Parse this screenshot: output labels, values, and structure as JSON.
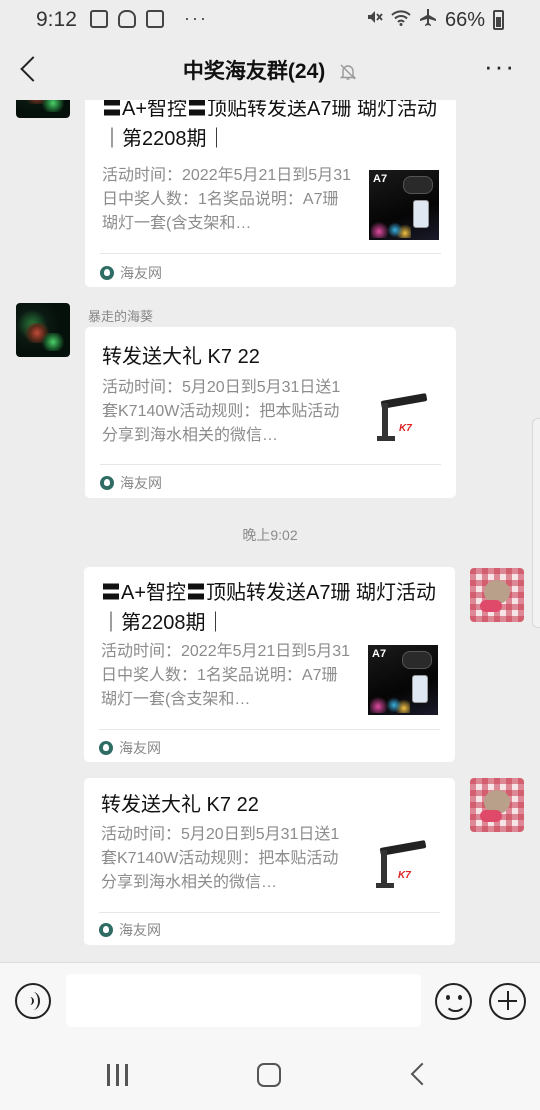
{
  "status_bar": {
    "time": "9:12",
    "more": "···",
    "battery": "66%",
    "icons": [
      "gallery-icon",
      "cloud-icon",
      "d-icon",
      "mute-icon",
      "wifi-icon",
      "airplane-icon",
      "battery-icon"
    ]
  },
  "header": {
    "title": "中奖海友群(24)",
    "more": "···"
  },
  "messages": [
    {
      "direction": "incoming",
      "sender": "",
      "card": {
        "title": "〓A+智控〓顶贴转发送A7珊 瑚灯活动｜第2208期｜",
        "desc": "活动时间：2022年5月21日到5月31日中奖人数：1名奖品说明：A7珊瑚灯一套(含支架和…",
        "thumb_label": "A7",
        "source": "海友网"
      }
    },
    {
      "direction": "incoming",
      "sender": "暴走的海葵",
      "card": {
        "title": "转发送大礼 K7 22",
        "desc": "活动时间：5月20日到5月31日送1套K7140W活动规则：把本贴活动分享到海水相关的微信…",
        "thumb_label": "K7",
        "source": "海友网"
      }
    },
    {
      "time_divider": "晚上9:02"
    },
    {
      "direction": "outgoing",
      "card": {
        "title": "〓A+智控〓顶贴转发送A7珊 瑚灯活动｜第2208期｜",
        "desc": "活动时间：2022年5月21日到5月31日中奖人数：1名奖品说明：A7珊瑚灯一套(含支架和…",
        "thumb_label": "A7",
        "source": "海友网"
      }
    },
    {
      "direction": "outgoing",
      "card": {
        "title": "转发送大礼 K7 22",
        "desc": "活动时间：5月20日到5月31日送1套K7140W活动规则：把本贴活动分享到海水相关的微信…",
        "thumb_label": "K7",
        "source": "海友网"
      }
    }
  ],
  "input": {
    "value": "",
    "placeholder": ""
  },
  "colors": {
    "background": "#ededed",
    "card": "#ffffff",
    "muted_text": "#8c8c8c"
  }
}
